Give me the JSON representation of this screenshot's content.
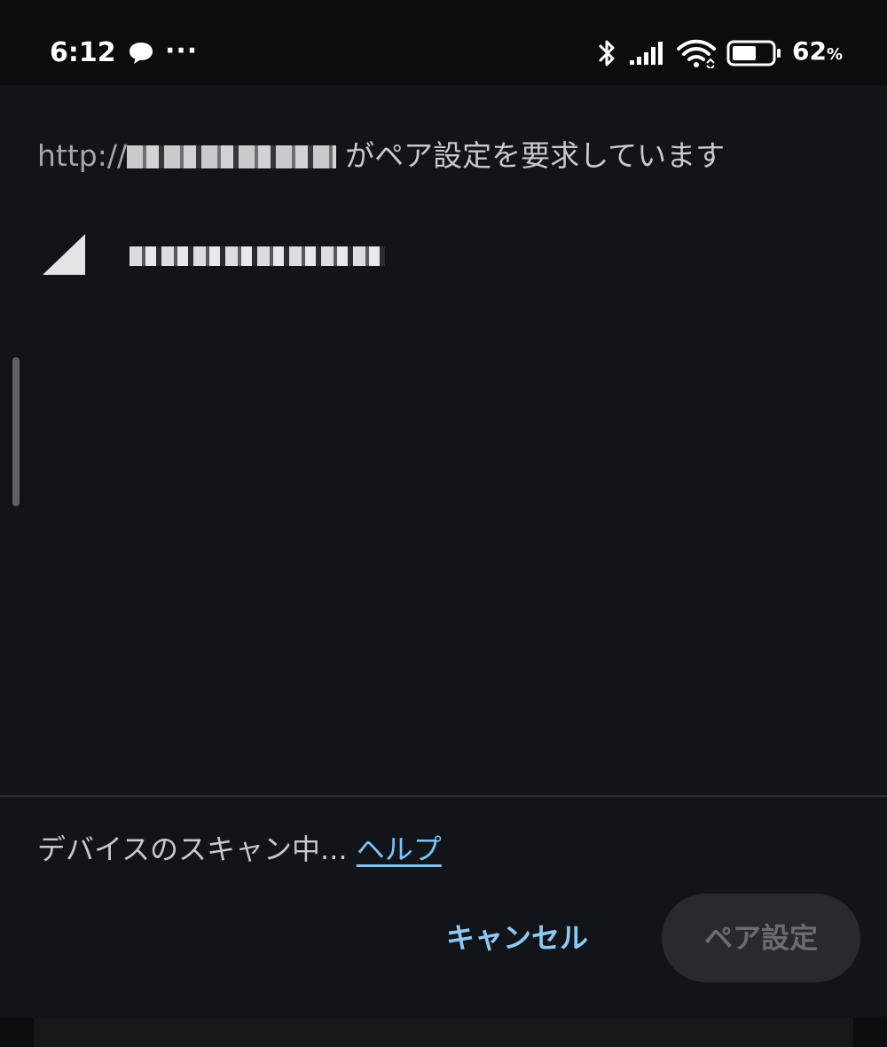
{
  "status_bar": {
    "time": "6:12",
    "more": "···",
    "battery_percent": "62",
    "battery_unit": "%",
    "battery_level": 0.62,
    "icons": [
      "chat-bubble-icon",
      "bluetooth-icon",
      "cellular-signal-icon",
      "wifi-icon",
      "battery-icon"
    ]
  },
  "dialog": {
    "title_prefix": "http://",
    "title_suffix": "がペア設定を要求しています",
    "scan_status": "デバイスのスキャン中...",
    "help_label": "ヘルプ",
    "cancel_label": "キャンセル",
    "pair_label": "ペア設定"
  },
  "colors": {
    "background": "#111418",
    "accent": "#8ec9f5",
    "disabled_button_bg": "#272a2e",
    "disabled_button_text": "#696d73"
  }
}
